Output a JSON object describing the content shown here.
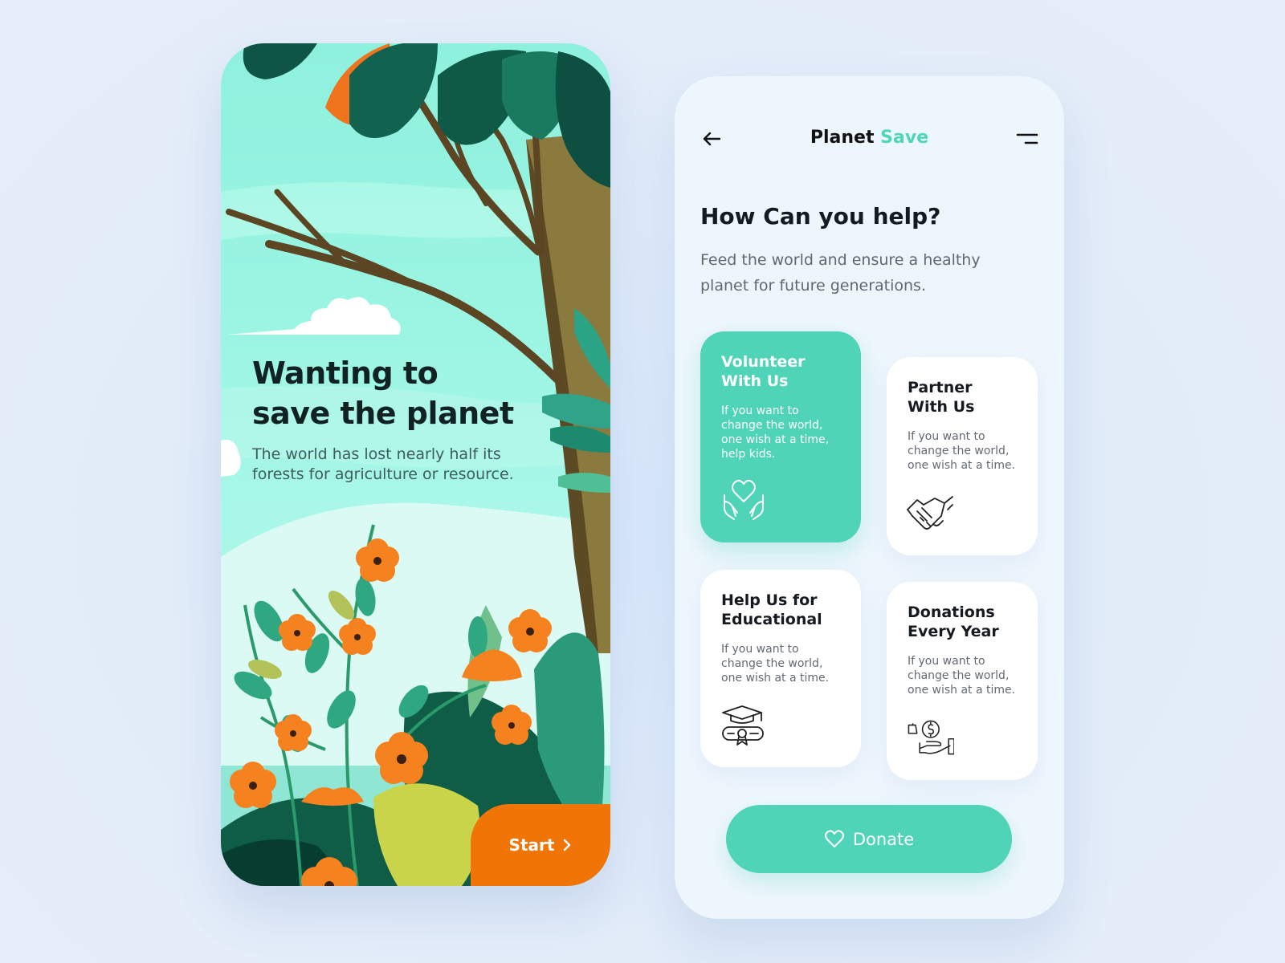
{
  "left_screen": {
    "title": "Wanting to save the planet",
    "subtitle": "The world has lost nearly half its forests for agriculture or resource.",
    "start_label": "Start"
  },
  "right_screen": {
    "app_title_primary": "Planet",
    "app_title_accent": "Save",
    "section_title": "How Can you help?",
    "section_subtitle": "Feed the world and ensure a healthy planet for future generations.",
    "cards": [
      {
        "title": "Volunteer With Us",
        "desc": "If you want to change the world, one wish at a time, help kids.",
        "icon": "heart-hands-icon",
        "active": true
      },
      {
        "title": "Partner With Us",
        "desc": "If you want to change the world, one wish at a time.",
        "icon": "handshake-icon",
        "active": false
      },
      {
        "title": "Help Us for Educational",
        "desc": "If you want to change the world, one wish at a time.",
        "icon": "graduation-icon",
        "active": false
      },
      {
        "title": "Donations Every Year",
        "desc": "If you want to change the world, one wish at a time.",
        "icon": "donation-hand-icon",
        "active": false
      }
    ],
    "donate_label": "Donate"
  },
  "colors": {
    "accent": "#4fd4b8",
    "orange": "#f07506",
    "background": "#e2ecf9"
  }
}
